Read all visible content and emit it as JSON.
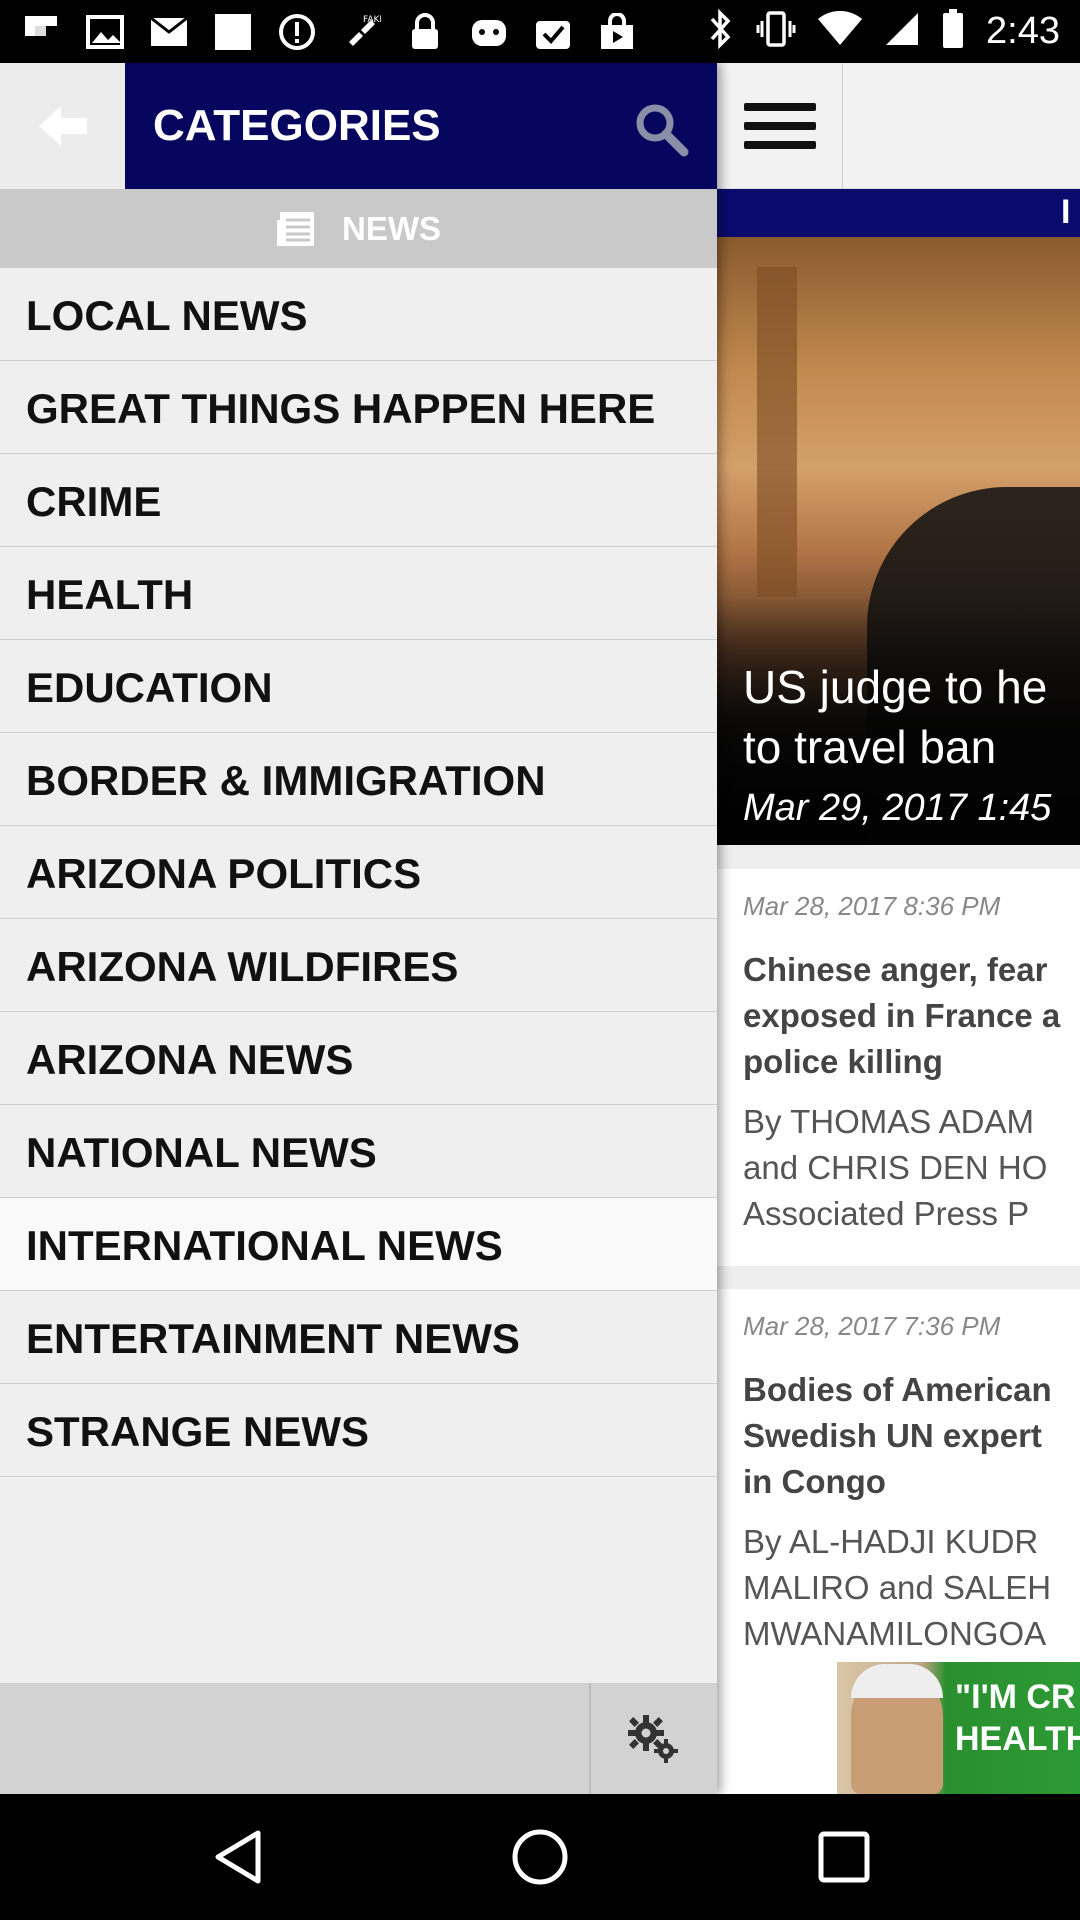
{
  "status_bar": {
    "time": "2:43",
    "left_icons": [
      "flipboard-icon",
      "image-icon",
      "mail-icon",
      "blank-icon",
      "alert-icon",
      "fake-gps-icon",
      "lock-icon",
      "game-icon",
      "check-icon",
      "shop-icon"
    ],
    "right_icons": [
      "bluetooth-icon",
      "vibrate-icon",
      "wifi-icon",
      "signal-icon",
      "battery-icon"
    ]
  },
  "drawer": {
    "title": "CATEGORIES",
    "section_label": "NEWS",
    "items": [
      {
        "label": "LOCAL NEWS"
      },
      {
        "label": "GREAT THINGS HAPPEN HERE"
      },
      {
        "label": "CRIME"
      },
      {
        "label": "HEALTH"
      },
      {
        "label": "EDUCATION"
      },
      {
        "label": "BORDER & IMMIGRATION"
      },
      {
        "label": "ARIZONA POLITICS"
      },
      {
        "label": "ARIZONA WILDFIRES"
      },
      {
        "label": "ARIZONA NEWS"
      },
      {
        "label": "NATIONAL NEWS"
      },
      {
        "label": "INTERNATIONAL NEWS",
        "active": true
      },
      {
        "label": "ENTERTAINMENT NEWS"
      },
      {
        "label": "STRANGE NEWS"
      }
    ]
  },
  "content": {
    "bar_text": "I",
    "hero": {
      "title_line1": "US judge to he",
      "title_line2": "to travel ban",
      "date": "Mar 29, 2017 1:45"
    },
    "articles": [
      {
        "date": "Mar 28, 2017 8:36 PM",
        "title_lines": [
          "Chinese anger, fear",
          "exposed in France a",
          "police killing"
        ],
        "byline_lines": [
          "By THOMAS ADAM",
          "and CHRIS DEN HO",
          "Associated Press P"
        ]
      },
      {
        "date": "Mar 28, 2017 7:36 PM",
        "title_lines": [
          "Bodies of American",
          "Swedish UN expert",
          "in Congo"
        ],
        "byline_lines": [
          "By AL-HADJI KUDR",
          "MALIRO and SALEH",
          "MWANAMILONGOA"
        ]
      }
    ],
    "ad": {
      "text_line1": "\"I'M CR",
      "text_line2": "HEALTH"
    }
  },
  "colors": {
    "drawer_title_bg": "#06065e",
    "content_bar": "#0b0b6e",
    "drawer_bg": "#efefef",
    "news_bar_bg": "#c9c9c9"
  }
}
